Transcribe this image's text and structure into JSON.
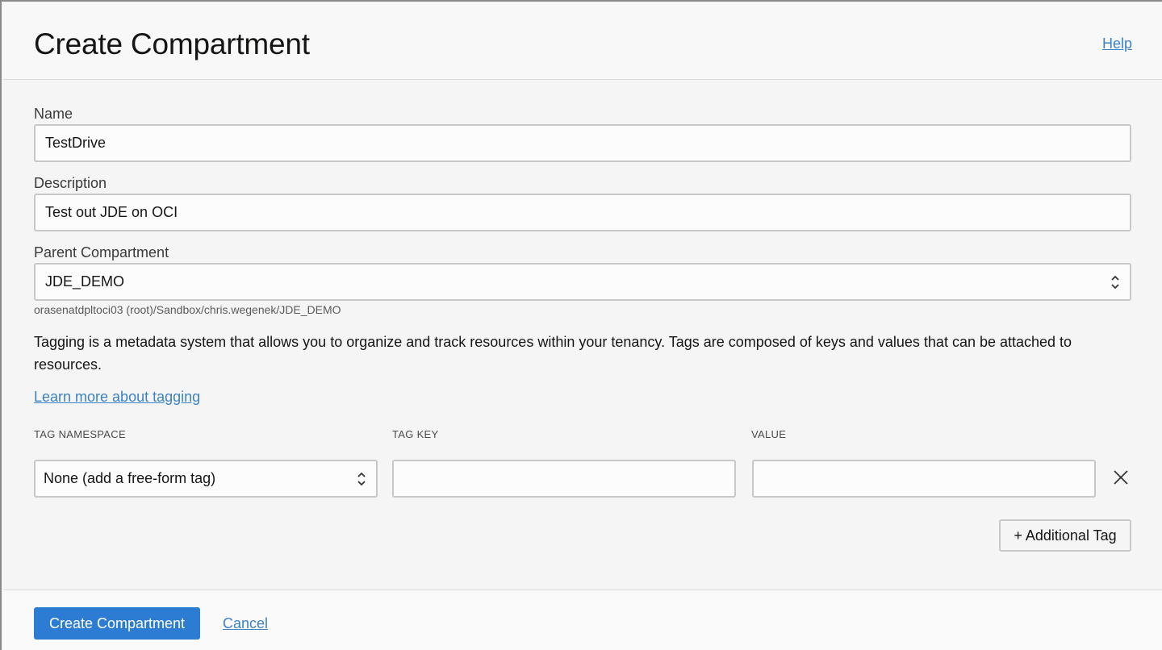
{
  "header": {
    "title": "Create Compartment",
    "help_label": "Help"
  },
  "form": {
    "name": {
      "label": "Name",
      "value": "TestDrive"
    },
    "description": {
      "label": "Description",
      "value": "Test out JDE on OCI"
    },
    "parent": {
      "label": "Parent Compartment",
      "value": "JDE_DEMO",
      "path": "orasenatdpltoci03 (root)/Sandbox/chris.wegenek/JDE_DEMO"
    },
    "tagging_text": "Tagging is a metadata system that allows you to organize and track resources within your tenancy. Tags are composed of keys and values that can be attached to resources.",
    "learn_more": "Learn more about tagging",
    "tags": {
      "namespace_header": "TAG NAMESPACE",
      "key_header": "TAG KEY",
      "value_header": "VALUE",
      "namespace_value": "None (add a free-form tag)",
      "key_value": "",
      "value_value": "",
      "remove_icon": "close-icon",
      "add_label": "+ Additional Tag"
    }
  },
  "footer": {
    "create_label": "Create Compartment",
    "cancel_label": "Cancel"
  },
  "colors": {
    "primary": "#2d7cd3",
    "link": "#3b82c4"
  }
}
